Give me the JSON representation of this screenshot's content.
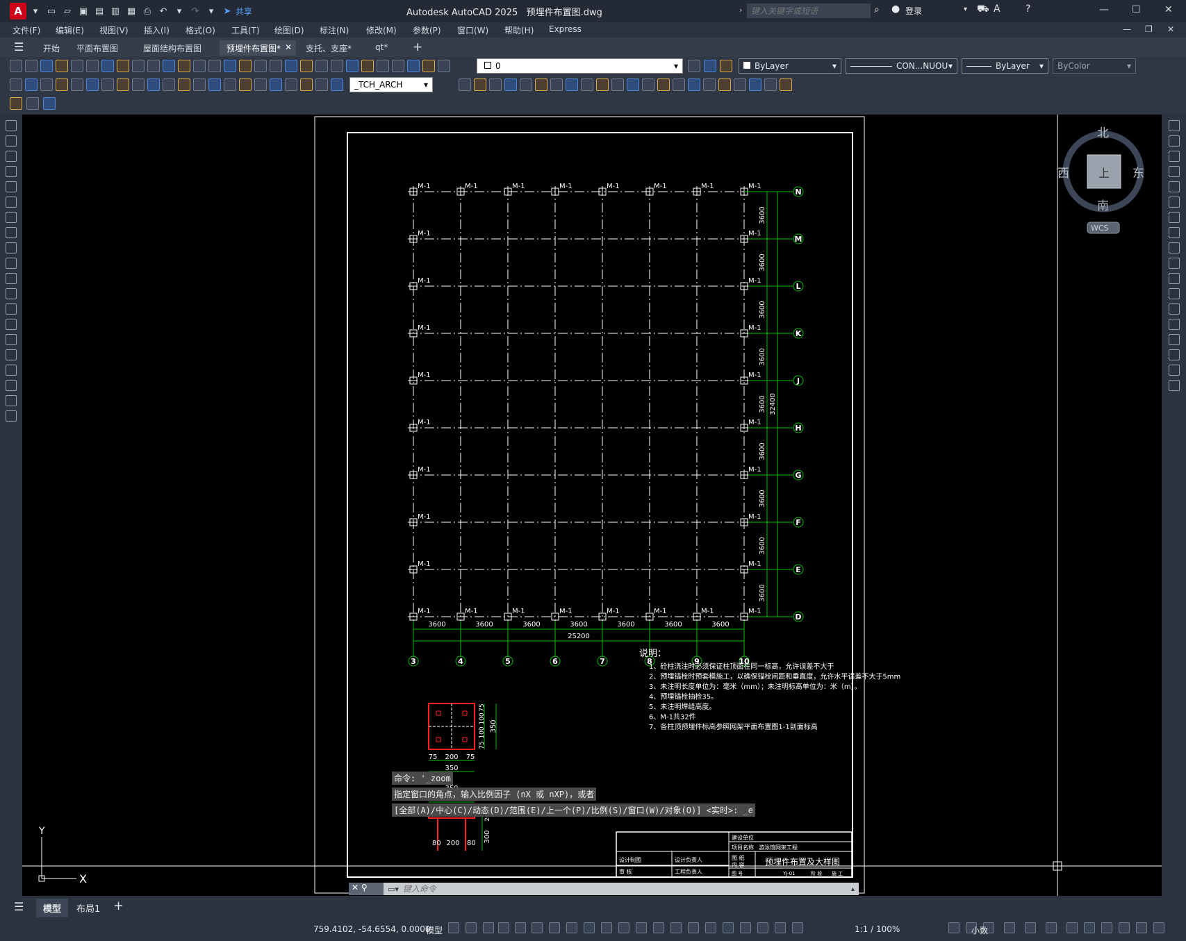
{
  "app": {
    "title": "Autodesk AutoCAD 2025",
    "document": "预埋件布置图.dwg",
    "share_label": "共享",
    "logo_letter": "A"
  },
  "search": {
    "placeholder": "键入关键字或短语"
  },
  "signin": "登录",
  "menu": [
    "文件(F)",
    "编辑(E)",
    "视图(V)",
    "插入(I)",
    "格式(O)",
    "工具(T)",
    "绘图(D)",
    "标注(N)",
    "修改(M)",
    "参数(P)",
    "窗口(W)",
    "帮助(H)",
    "Express"
  ],
  "tabs": [
    {
      "label": "开始",
      "active": false
    },
    {
      "label": "平面布置图",
      "active": false
    },
    {
      "label": "屋面结构布置图",
      "active": false
    },
    {
      "label": "预埋件布置图*",
      "active": true
    },
    {
      "label": "支托、支座*",
      "active": false
    },
    {
      "label": "qt*",
      "active": false
    }
  ],
  "properties": {
    "layer": "0",
    "color": "ByLayer",
    "linetype": "CON...NUOU",
    "lineweight": "ByLayer",
    "plotstyle": "ByColor",
    "textstyle": "_TCH_ARCH"
  },
  "viewcube": {
    "north": "北",
    "south": "南",
    "east": "东",
    "west": "西",
    "face": "上",
    "wcs": "WCS"
  },
  "ucs": {
    "x": "X",
    "y": "Y"
  },
  "drawing": {
    "grid_rows": [
      "N",
      "M",
      "L",
      "K",
      "J",
      "H",
      "G",
      "F",
      "E",
      "D"
    ],
    "grid_cols": [
      "3",
      "4",
      "5",
      "6",
      "7",
      "8",
      "9",
      "10"
    ],
    "bay_x": "3600",
    "bay_y": "3600",
    "total_x": "25200",
    "total_y": "32400",
    "embed_tag": "M-1",
    "notes_title": "说明：",
    "notes": [
      "1、砼柱浇注时必须保证柱顶面在同一标高，允许误差不大于",
      "2、预埋锚栓时预套模施工，以确保锚栓间距和垂直度，允许水平误差不大于5mm",
      "3、未注明长度单位为：毫米（mm）；未注明标高单位为：米（m）。",
      "4、预埋锚栓抽检35。",
      "5、未注明焊缝高度。",
      "6、M-1共32件",
      "7、各柱顶预埋件标高参照网架平面布置图1-1剖面标高"
    ],
    "detail_dims": {
      "w": "350",
      "a": "75",
      "b": "200",
      "c": "100",
      "h": "300",
      "d": "20",
      "e": "80"
    },
    "title_block": {
      "drawing_name": "预埋件布置及大样图",
      "unit_label": "建设单位",
      "project_label": "项目名称",
      "project": "游泳馆网架工程",
      "design": "设计制图",
      "check": "审 核",
      "designer_lead": "设计负责人",
      "eng_lead": "工程负责人",
      "drawing_label": "图 纸",
      "content_label": "内 容",
      "no_label": "图 号",
      "no": "YJ-01",
      "stage1": "阶 段",
      "stage2": "施 工"
    }
  },
  "command": {
    "history": [
      "命令: '_zoom",
      "指定窗口的角点，输入比例因子 (nX 或 nXP)，或者",
      "[全部(A)/中心(C)/动态(D)/范围(E)/上一个(P)/比例(S)/窗口(W)/对象(O)] <实时>: _e"
    ],
    "placeholder": "键入命令"
  },
  "layout_tabs": [
    {
      "label": "模型",
      "active": true
    },
    {
      "label": "布局1",
      "active": false
    }
  ],
  "status": {
    "coords": "759.4102, -54.6554, 0.0000",
    "space": "模型",
    "scale": "1:1 / 100%",
    "units": "小数"
  }
}
